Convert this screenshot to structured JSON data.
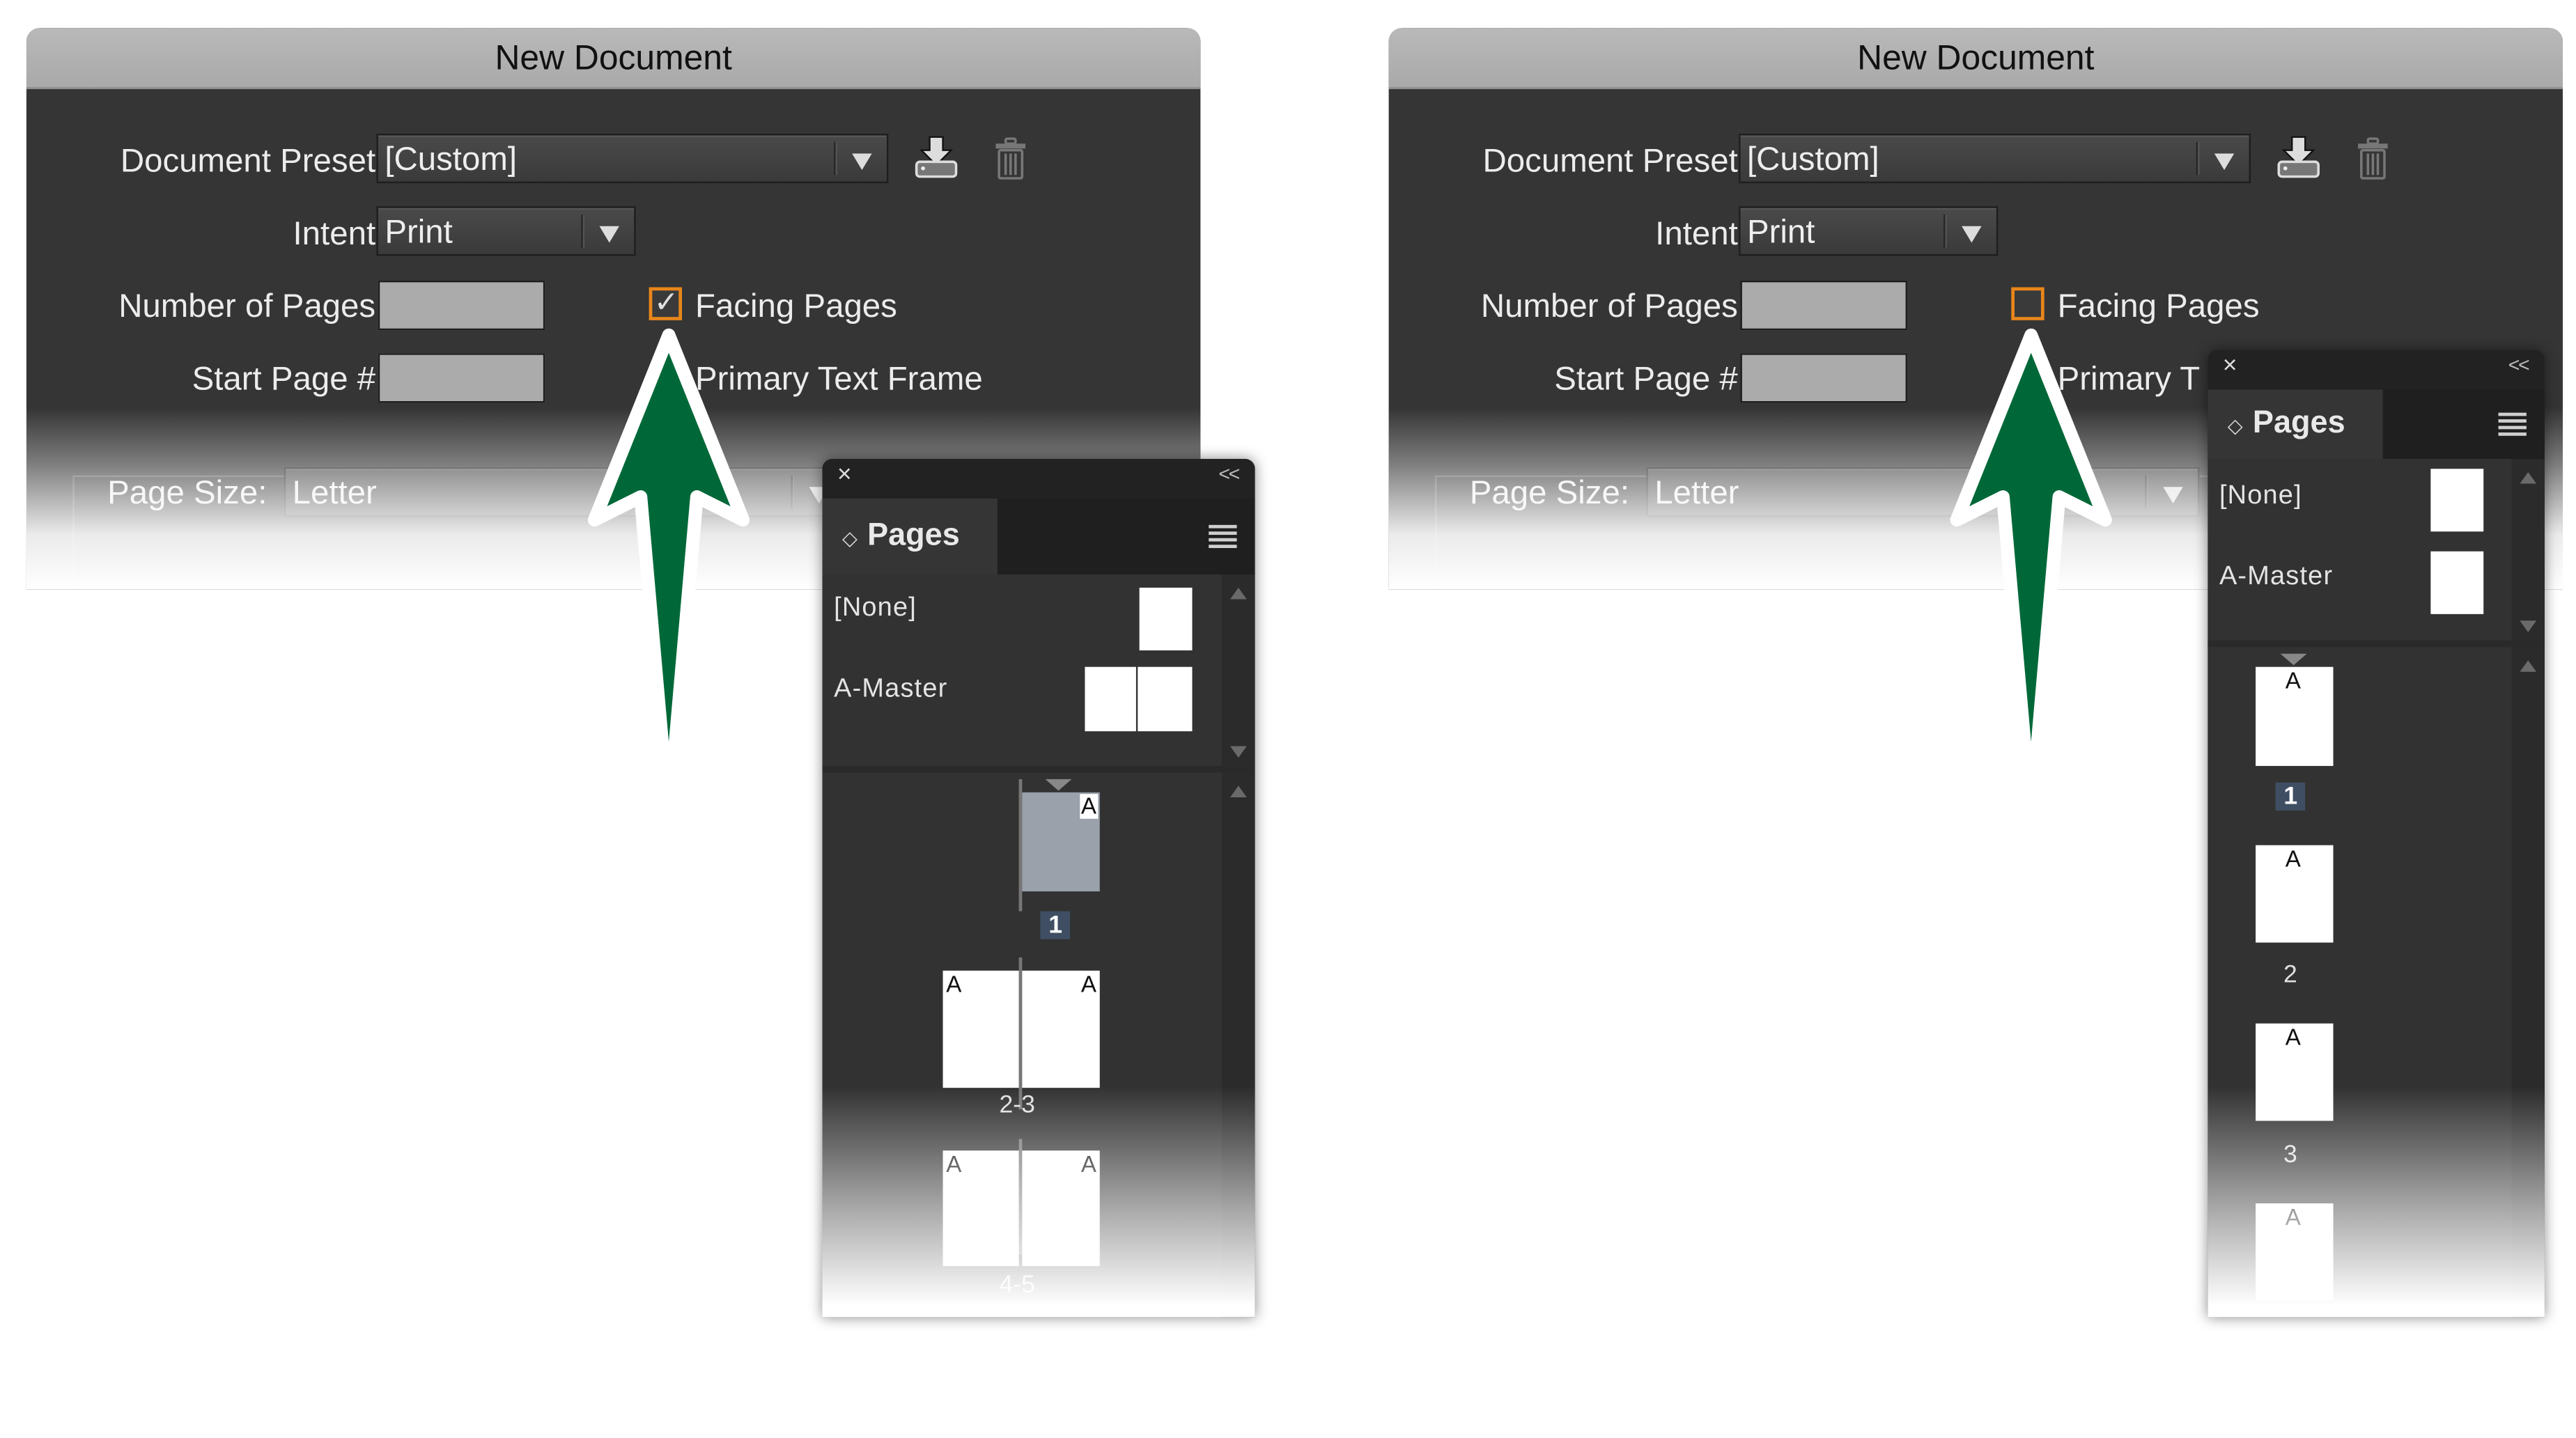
{
  "panels": [
    {
      "id": "facing-on",
      "dialog": {
        "title": "New Document",
        "document_preset_label": "Document Preset:",
        "document_preset_value": "[Custom]",
        "intent_label": "Intent:",
        "intent_value": "Print",
        "number_of_pages_label": "Number of Pages:",
        "number_of_pages_value": "",
        "start_page_label": "Start Page #:",
        "start_page_value": "",
        "facing_pages_label": "Facing Pages",
        "facing_pages_checked": true,
        "primary_text_frame_label": "Primary Text Frame",
        "page_size_label": "Page Size:",
        "page_size_value": "Letter",
        "save_preset_icon": "save-preset-icon",
        "delete_preset_icon": "trash-icon"
      },
      "pages_panel": {
        "close_icon": "×",
        "collapse_icon": "<<",
        "tab_label": "Pages",
        "masters": [
          "[None]",
          "A-Master"
        ],
        "page_groups": [
          {
            "label": "1",
            "master_letters": [
              "A"
            ],
            "selected": true
          },
          {
            "label": "2-3",
            "master_letters": [
              "A",
              "A"
            ],
            "selected": false
          },
          {
            "label": "4-5",
            "master_letters": [
              "A",
              "A"
            ],
            "selected": false
          }
        ]
      }
    },
    {
      "id": "facing-off",
      "dialog": {
        "title": "New Document",
        "document_preset_label": "Document Preset:",
        "document_preset_value": "[Custom]",
        "intent_label": "Intent:",
        "intent_value": "Print",
        "number_of_pages_label": "Number of Pages:",
        "number_of_pages_value": "",
        "start_page_label": "Start Page #:",
        "start_page_value": "",
        "facing_pages_label": "Facing Pages",
        "facing_pages_checked": false,
        "primary_text_frame_label": "Primary T",
        "page_size_label": "Page Size:",
        "page_size_value": "Letter",
        "save_preset_icon": "save-preset-icon",
        "delete_preset_icon": "trash-icon"
      },
      "pages_panel": {
        "close_icon": "×",
        "collapse_icon": "<<",
        "tab_label": "Pages",
        "masters": [
          "[None]",
          "A-Master"
        ],
        "page_groups": [
          {
            "label": "1",
            "master_letters": [
              "A"
            ],
            "selected": true
          },
          {
            "label": "2",
            "master_letters": [
              "A"
            ],
            "selected": false
          },
          {
            "label": "3",
            "master_letters": [
              "A"
            ],
            "selected": false
          },
          {
            "label": "",
            "master_letters": [
              "A"
            ],
            "selected": false
          }
        ]
      }
    }
  ],
  "colors": {
    "dialog_bg": "#353535",
    "titlebar": "#b0b0b0",
    "checkbox_focus": "#e8861a",
    "arrow_fill": "#006838",
    "arrow_outline": "#ffffff",
    "selected_page_label": "#3f4e63"
  },
  "annotation": {
    "arrow_icon": "up-arrow-icon",
    "points_to": "Facing Pages checkbox"
  }
}
